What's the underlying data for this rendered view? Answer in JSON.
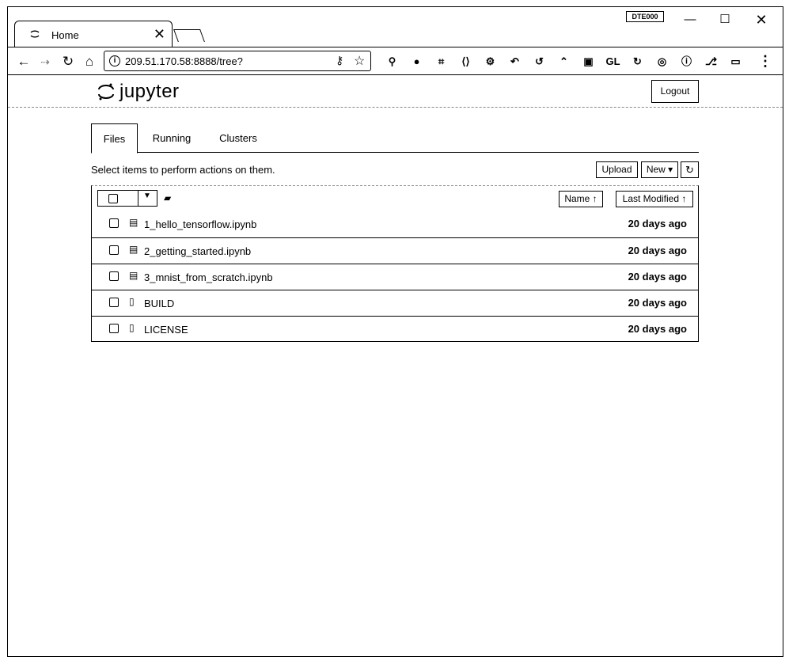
{
  "browser": {
    "tab_title": "Home",
    "tab_close": "✕",
    "profile": "DTE000",
    "url": "209.51.170.58:8888/tree?",
    "extensions": [
      "ext-1",
      "ext-2",
      "ext-3",
      "ext-4",
      "ext-5",
      "ext-6",
      "ext-7",
      "ext-8",
      "ext-9",
      "GL",
      "ext-11",
      "ext-12",
      "ext-13",
      "ext-14",
      "ext-15"
    ],
    "extensions_labels": [
      "⚲",
      "●",
      "⌗",
      "⟨⟩",
      "⚙",
      "↶",
      "↺",
      "⌃",
      "▣",
      "GL",
      "↻",
      "◎",
      "ⓘ",
      "⎇",
      "▭"
    ]
  },
  "jupyter": {
    "logo_text": "jupyter",
    "logout_label": "Logout",
    "tabs": [
      "Files",
      "Running",
      "Clusters"
    ],
    "hint": "Select items to perform actions on them.",
    "upload_label": "Upload",
    "new_label": "New ▾",
    "refresh_label": "↻",
    "sort_name_label": "Name ↑",
    "sort_modified_label": "Last Modified ↑",
    "files": [
      {
        "name": "1_hello_tensorflow.ipynb",
        "modified": "20 days ago",
        "type": "notebook"
      },
      {
        "name": "2_getting_started.ipynb",
        "modified": "20 days ago",
        "type": "notebook"
      },
      {
        "name": "3_mnist_from_scratch.ipynb",
        "modified": "20 days ago",
        "type": "notebook"
      },
      {
        "name": "BUILD",
        "modified": "20 days ago",
        "type": "file"
      },
      {
        "name": "LICENSE",
        "modified": "20 days ago",
        "type": "file"
      }
    ]
  }
}
